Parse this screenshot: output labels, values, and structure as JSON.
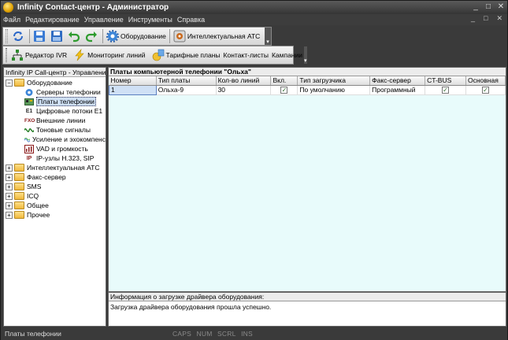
{
  "window": {
    "title": "Infinity Contact-центр  - Администратор",
    "controls": [
      "_",
      "□",
      "✕"
    ]
  },
  "menu": {
    "items": [
      "Файл",
      "Редактирование",
      "Управление",
      "Инструменты",
      "Справка"
    ],
    "mdi_controls": [
      "_",
      "□",
      "✕"
    ]
  },
  "toolbar1": {
    "equipment_label": "Оборудование",
    "pbx_label": "Интеллектуальная АТС",
    "chevron": "▾"
  },
  "toolbar2": {
    "ivr_label": "Редактор IVR",
    "monitor_label": "Мониторинг линий",
    "tariff_label": "Тарифные планы",
    "contacts_label": "Контакт-листы",
    "campaigns_label": "Кампании",
    "chevron": "▾"
  },
  "tree": {
    "header": "Infinity IP Call-центр - Управление",
    "root_open": {
      "label": "Оборудование",
      "toggle": "−"
    },
    "children": [
      {
        "label": "Серверы телефонии",
        "icon": "server-icon"
      },
      {
        "label": "Платы телефонии",
        "icon": "board-icon"
      },
      {
        "label": "Цифровые потоки E1",
        "icon": "e1-icon",
        "glyph": "E1"
      },
      {
        "label": "Внешние линии",
        "icon": "fxo-icon",
        "glyph": "FXO"
      },
      {
        "label": "Тоновые сигналы",
        "icon": "wave-icon"
      },
      {
        "label": "Усиление и эхокомпенс",
        "icon": "gain-icon"
      },
      {
        "label": "VAD и громкость",
        "icon": "vad-icon"
      },
      {
        "label": "IP-узлы H.323, SIP",
        "icon": "ip-icon",
        "glyph": "IP"
      }
    ],
    "closed": [
      {
        "label": "Интеллектуальная АТС",
        "toggle": "+"
      },
      {
        "label": "Факс-сервер",
        "toggle": "+"
      },
      {
        "label": "SMS",
        "toggle": "+"
      },
      {
        "label": "ICQ",
        "toggle": "+"
      },
      {
        "label": "Общее",
        "toggle": "+"
      },
      {
        "label": "Прочее",
        "toggle": "+"
      }
    ]
  },
  "grid": {
    "title": "Платы компьютерной телефонии \"Ольха\"",
    "columns": [
      "Номер",
      "Тип платы",
      "Кол-во линий",
      "Вкл.",
      "Тип загрузчика",
      "Факс-сервер",
      "CT-BUS",
      "Основная"
    ],
    "rows": [
      {
        "num": "1",
        "type": "Ольха-9",
        "lines": "30",
        "on": "✓",
        "loader": "По умолчанию",
        "fax": "Программный",
        "ctbus": "✓",
        "main": "✓"
      }
    ]
  },
  "info": {
    "header": "Информация о загрузке драйвера оборудования:",
    "message": "Загрузка драйвера оборудования прошла успешно."
  },
  "status": {
    "text": "Платы телефонии",
    "keys": [
      "CAPS",
      "NUM",
      "SCRL",
      "INS"
    ]
  },
  "colors": {
    "grid_background": "#e8fbfb",
    "selection": "#cfe0f5",
    "chrome": "#3a3a3a"
  }
}
